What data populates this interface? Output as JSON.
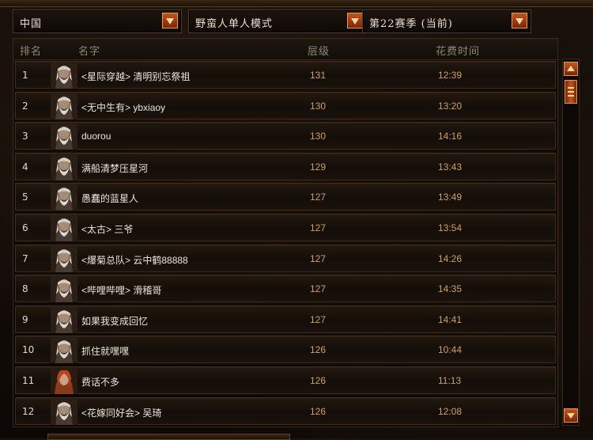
{
  "filters": {
    "region": "中国",
    "mode": "野蛮人单人模式",
    "season": "第22赛季 (当前)"
  },
  "columns": {
    "rank": "排名",
    "name": "名字",
    "level": "层级",
    "time": "花费时间"
  },
  "rows": [
    {
      "rank": "1",
      "name": "<星际穿越> 清明别忘祭祖",
      "level": "131",
      "time": "12:39",
      "portrait": "old-barbarian"
    },
    {
      "rank": "2",
      "name": "<无中生有> ybxiaoy",
      "level": "130",
      "time": "13:20",
      "portrait": "old-barbarian"
    },
    {
      "rank": "3",
      "name": "duorou",
      "level": "130",
      "time": "14:16",
      "portrait": "old-barbarian"
    },
    {
      "rank": "4",
      "name": "满船清梦压星河",
      "level": "129",
      "time": "13:43",
      "portrait": "old-barbarian"
    },
    {
      "rank": "5",
      "name": "愚蠢的蓝星人",
      "level": "127",
      "time": "13:49",
      "portrait": "old-barbarian"
    },
    {
      "rank": "6",
      "name": "<太古> 三爷",
      "level": "127",
      "time": "13:54",
      "portrait": "old-barbarian"
    },
    {
      "rank": "7",
      "name": "<爆菊总队> 云中鹤88888",
      "level": "127",
      "time": "14:26",
      "portrait": "old-barbarian"
    },
    {
      "rank": "8",
      "name": "<哔哩哔哩> 滑稽哥",
      "level": "127",
      "time": "14:35",
      "portrait": "old-barbarian"
    },
    {
      "rank": "9",
      "name": "如果我变成回忆",
      "level": "127",
      "time": "14:41",
      "portrait": "old-barbarian"
    },
    {
      "rank": "10",
      "name": "抓住就嘿嘿",
      "level": "126",
      "time": "10:44",
      "portrait": "old-barbarian"
    },
    {
      "rank": "11",
      "name": "费话不多",
      "level": "126",
      "time": "11:13",
      "portrait": "red-haired-barbarian"
    },
    {
      "rank": "12",
      "name": "<花嫁同好会> 吴琦",
      "level": "126",
      "time": "12:08",
      "portrait": "old-barbarian"
    }
  ],
  "colors": {
    "accent": "#c2541d",
    "level_text": "#d2a05c",
    "name_text": "#ece6d8",
    "header_text": "#8d8678"
  }
}
